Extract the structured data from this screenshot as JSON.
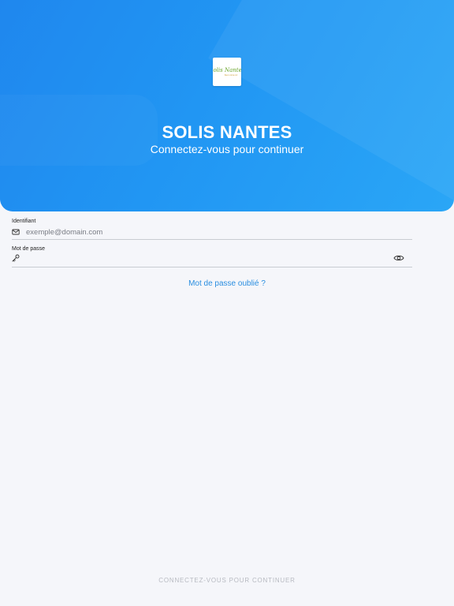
{
  "header": {
    "logo": {
      "text": "Solis Nantes",
      "subtext": "bien vivre ici"
    },
    "title": "SOLIS NANTES",
    "subtitle": "Connectez-vous pour continuer"
  },
  "form": {
    "identifier": {
      "label": "Identifiant",
      "placeholder": "exemple@domain.com",
      "value": "",
      "icon": "envelope-icon"
    },
    "password": {
      "label": "Mot de passe",
      "placeholder": "",
      "value": "",
      "icon": "key-icon",
      "toggle_icon": "eye-icon"
    },
    "forgot_password": "Mot de passe oublié ?"
  },
  "footer": {
    "cta": "CONNECTEZ-VOUS POUR CONTINUER"
  },
  "colors": {
    "primary": "#2196f3",
    "link": "#2a8ee0",
    "background": "#f5f6fa",
    "disabled_text": "#b7bac1"
  }
}
